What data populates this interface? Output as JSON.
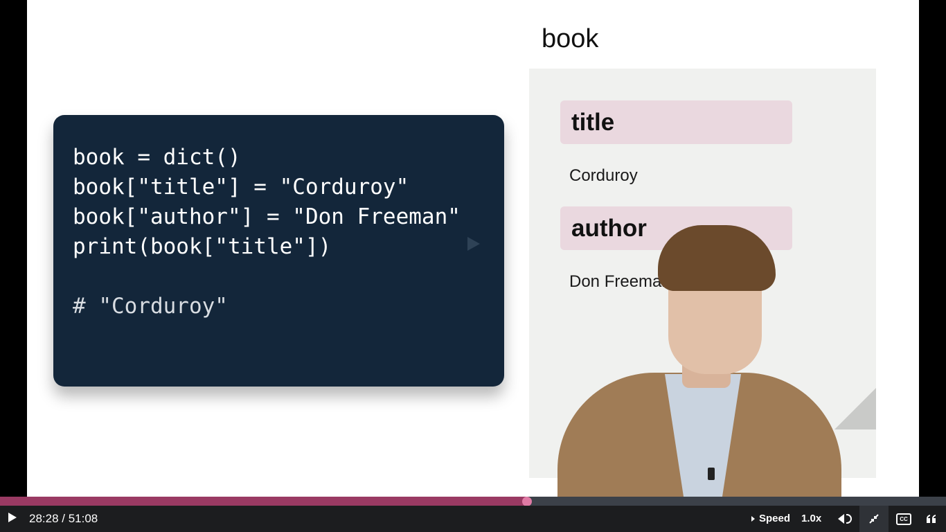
{
  "slide": {
    "code_lines": [
      "book = dict()",
      "book[\"title\"] = \"Corduroy\"",
      "book[\"author\"] = \"Don Freeman\"",
      "print(book[\"title\"])"
    ],
    "code_comment": "# \"Corduroy\"",
    "dict_title": "book",
    "entries": [
      {
        "key": "title",
        "value": "Corduroy"
      },
      {
        "key": "author",
        "value": "Don Freeman"
      }
    ]
  },
  "player": {
    "current_time": "28:28",
    "duration": "51:08",
    "time_display": "28:28 / 51:08",
    "progress_fraction": 0.557,
    "speed_label": "Speed",
    "speed_value": "1.0x",
    "icons": [
      "play-icon",
      "volume-icon",
      "exit-fullscreen-icon",
      "closed-captions-icon",
      "quote-icon"
    ]
  }
}
